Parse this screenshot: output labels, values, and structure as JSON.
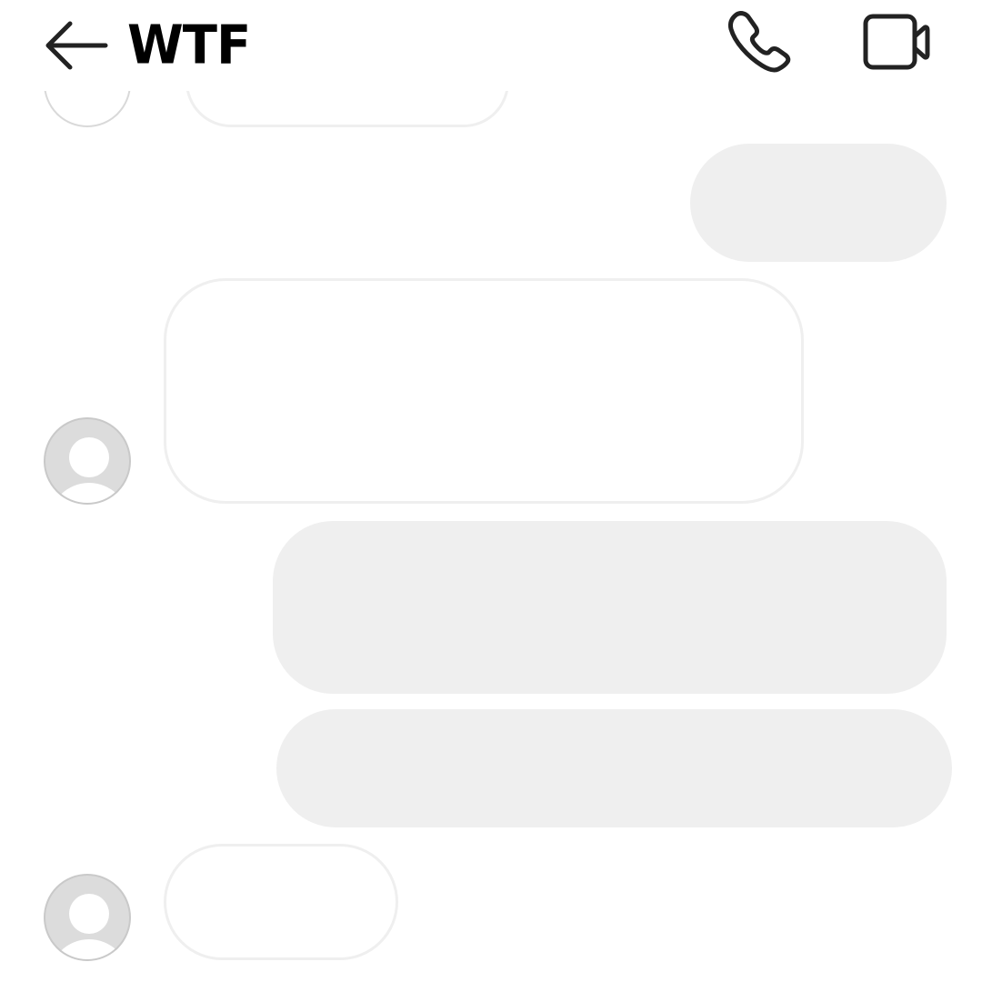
{
  "header": {
    "title": "WTF",
    "back_icon": "arrow-left-icon",
    "call_icon": "phone-icon",
    "video_icon": "video-camera-icon"
  },
  "colors": {
    "background": "#ffffff",
    "outgoing_bubble": "#efefef",
    "incoming_bubble_border": "#efefef",
    "avatar_placeholder": "#dcdcdc",
    "icon": "#222222"
  },
  "messages": [
    {
      "direction": "incoming",
      "text": ""
    },
    {
      "direction": "outgoing",
      "text": ""
    },
    {
      "direction": "incoming",
      "text": ""
    },
    {
      "direction": "outgoing",
      "text": ""
    },
    {
      "direction": "outgoing",
      "text": ""
    },
    {
      "direction": "incoming",
      "text": ""
    }
  ]
}
